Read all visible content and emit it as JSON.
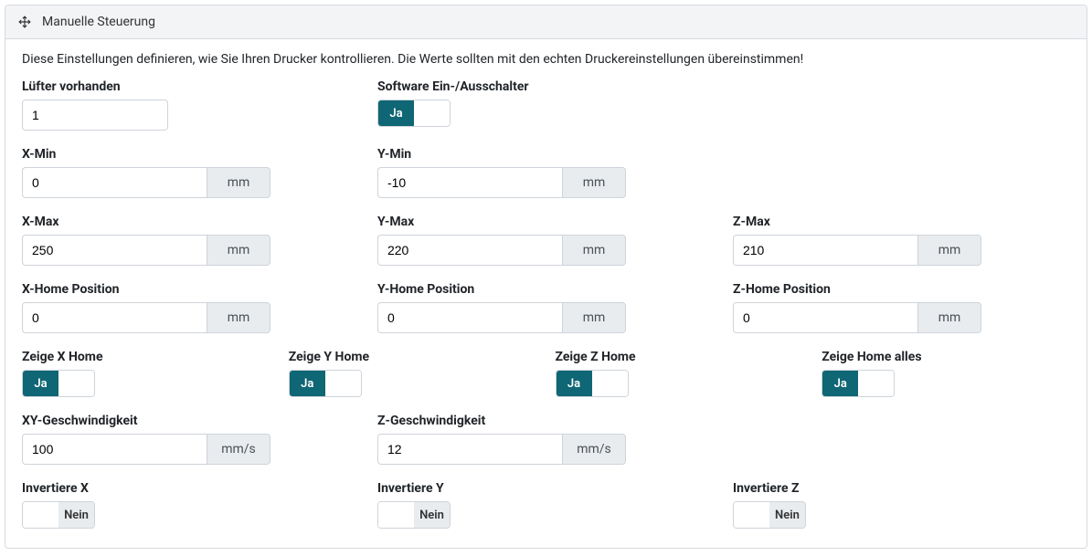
{
  "header": {
    "title": "Manuelle Steuerung"
  },
  "description": "Diese Einstellungen definieren, wie Sie Ihren Drucker kontrollieren. Die Werte sollten mit den echten Druckereinstellungen übereinstimmen!",
  "labels": {
    "fan": "Lüfter vorhanden",
    "softswitch": "Software Ein-/Ausschalter",
    "xmin": "X-Min",
    "ymin": "Y-Min",
    "xmax": "X-Max",
    "ymax": "Y-Max",
    "zmax": "Z-Max",
    "xhome": "X-Home Position",
    "yhome": "Y-Home Position",
    "zhome": "Z-Home Position",
    "showxh": "Zeige X Home",
    "showyh": "Zeige Y Home",
    "showzh": "Zeige Z Home",
    "showallh": "Zeige Home alles",
    "xyspeed": "XY-Geschwindigkeit",
    "zspeed": "Z-Geschwindigkeit",
    "invx": "Invertiere X",
    "invy": "Invertiere Y",
    "invz": "Invertiere Z"
  },
  "values": {
    "fan": "1",
    "xmin": "0",
    "ymin": "-10",
    "xmax": "250",
    "ymax": "220",
    "zmax": "210",
    "xhome": "0",
    "yhome": "0",
    "zhome": "0",
    "xyspeed": "100",
    "zspeed": "12"
  },
  "units": {
    "mm": "mm",
    "mms": "mm/s"
  },
  "toggle": {
    "yes": "Ja",
    "no": "Nein"
  },
  "toggles": {
    "softswitch": "yes",
    "showxh": "yes",
    "showyh": "yes",
    "showzh": "yes",
    "showallh": "yes",
    "invx": "no",
    "invy": "no",
    "invz": "no"
  }
}
